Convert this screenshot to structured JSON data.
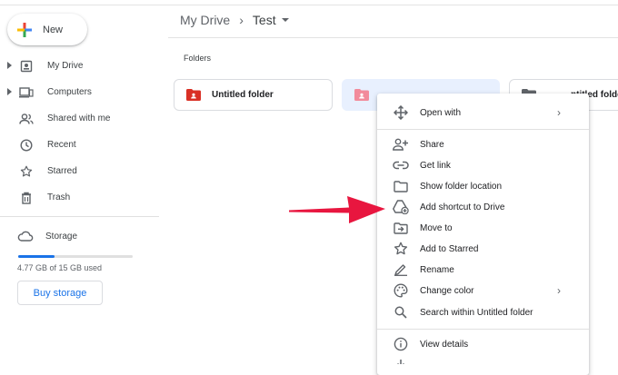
{
  "sidebar": {
    "new_label": "New",
    "items": [
      {
        "label": "My Drive",
        "icon": "drive-icon",
        "caret": true
      },
      {
        "label": "Computers",
        "icon": "computers-icon",
        "caret": true
      },
      {
        "label": "Shared with me",
        "icon": "shared-icon",
        "caret": false
      },
      {
        "label": "Recent",
        "icon": "clock-icon",
        "caret": false
      },
      {
        "label": "Starred",
        "icon": "star-icon",
        "caret": false
      },
      {
        "label": "Trash",
        "icon": "trash-icon",
        "caret": false
      }
    ],
    "storage_label": "Storage",
    "storage_used_text": "4.77 GB of 15 GB used",
    "storage_fraction": 0.318,
    "buy_label": "Buy storage"
  },
  "breadcrumb": {
    "root": "My Drive",
    "current": "Test"
  },
  "main": {
    "folders_heading": "Folders",
    "folders": [
      {
        "label": "Untitled folder",
        "selected": false
      },
      {
        "label": "",
        "selected": true
      },
      {
        "label": "ntitled folder",
        "selected": false
      }
    ]
  },
  "context_menu": {
    "groups": [
      [
        {
          "label": "Open with",
          "icon": "move-icon",
          "submenu": true
        }
      ],
      [
        {
          "label": "Share",
          "icon": "share-person-icon"
        },
        {
          "label": "Get link",
          "icon": "link-icon"
        },
        {
          "label": "Show folder location",
          "icon": "folder-outline-icon"
        },
        {
          "label": "Add shortcut to Drive",
          "icon": "add-shortcut-icon"
        },
        {
          "label": "Move to",
          "icon": "move-to-icon"
        },
        {
          "label": "Add to Starred",
          "icon": "star-icon"
        },
        {
          "label": "Rename",
          "icon": "pencil-icon"
        },
        {
          "label": "Change color",
          "icon": "palette-icon",
          "submenu": true
        },
        {
          "label": "Search within Untitled folder",
          "icon": "search-icon"
        }
      ],
      [
        {
          "label": "View details",
          "icon": "info-icon"
        }
      ]
    ]
  },
  "colors": {
    "accent": "#1a73e8",
    "annotation_arrow": "#e8163f",
    "folder_red": "#d93025",
    "folder_pink": "#f28b9b"
  }
}
